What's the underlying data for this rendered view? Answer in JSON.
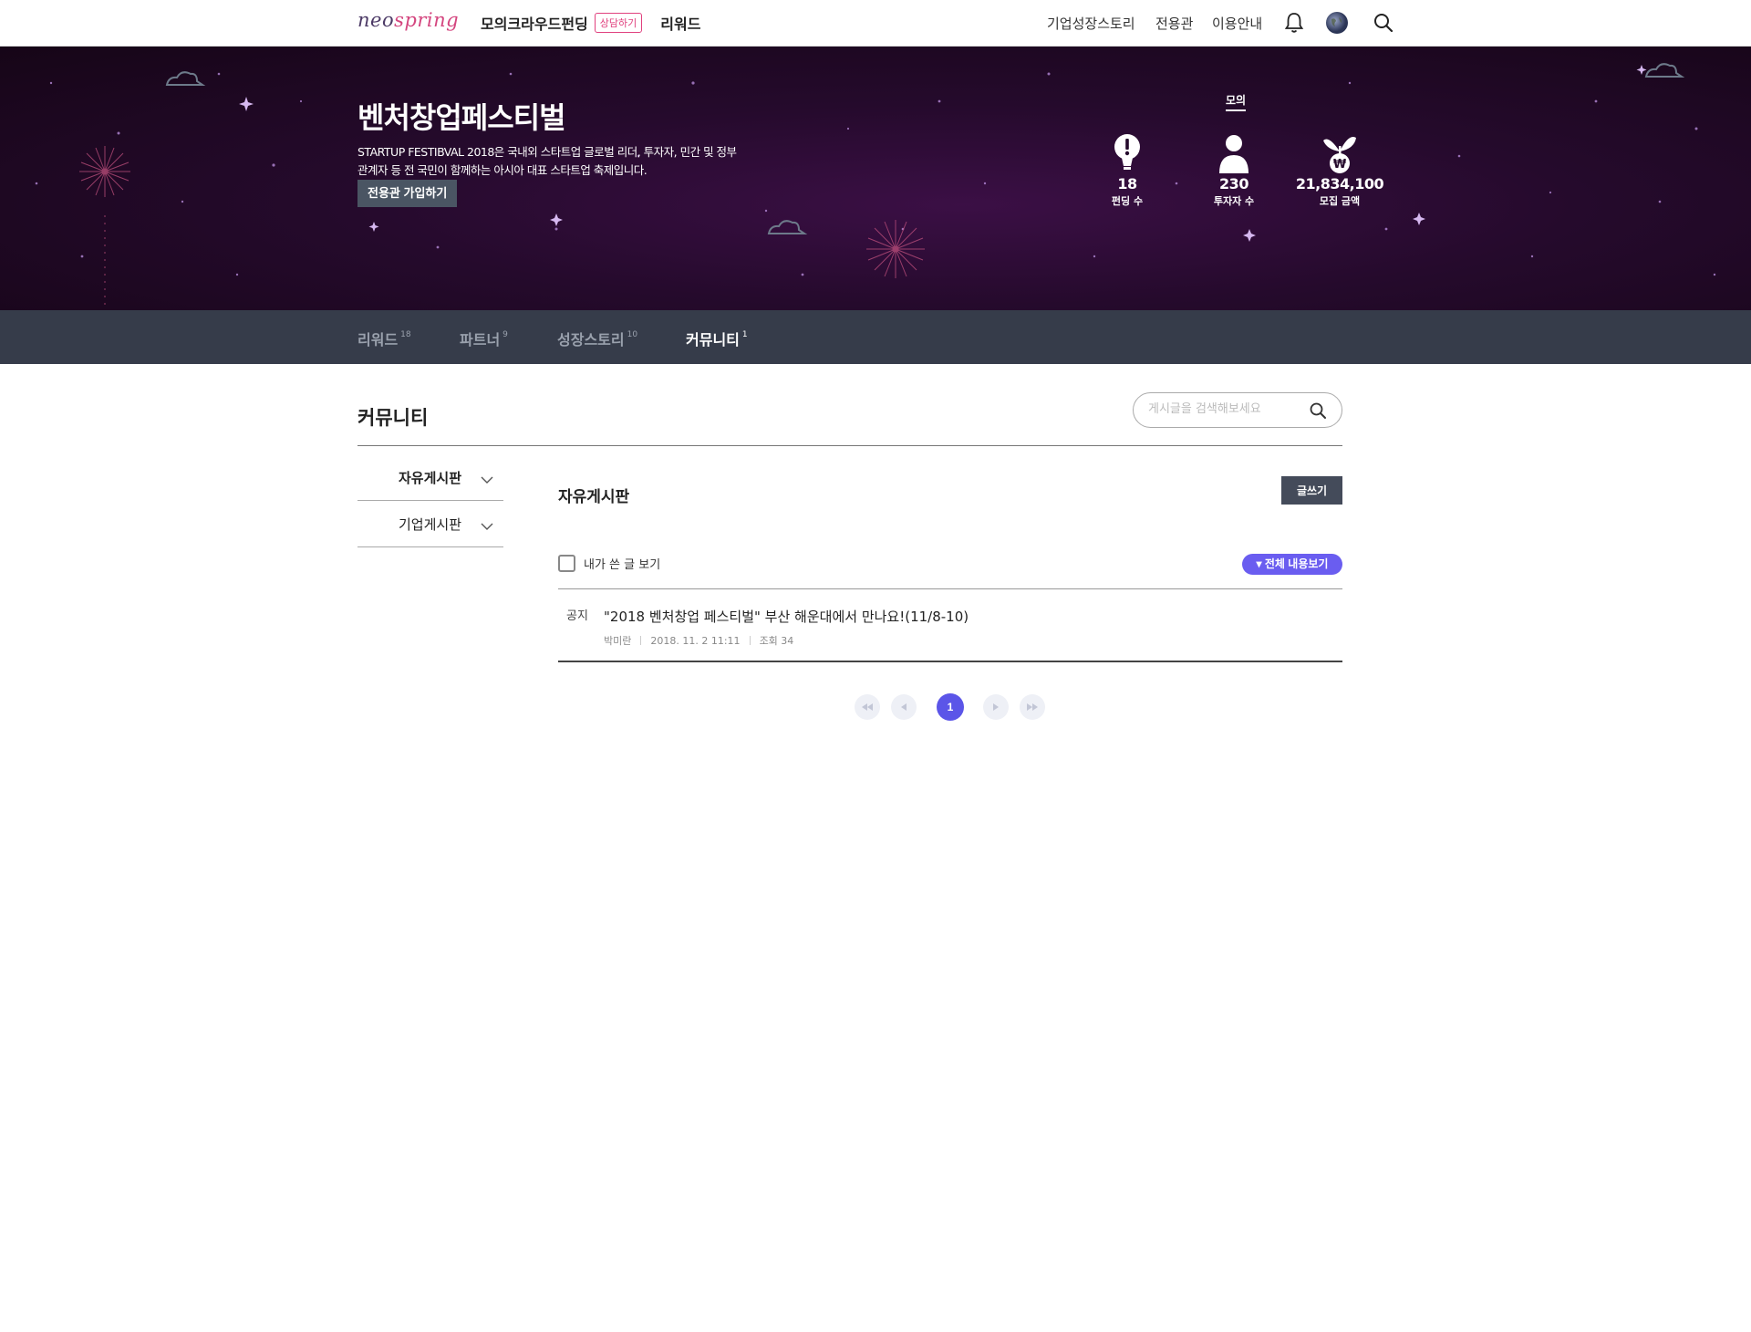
{
  "header": {
    "logo_part1": "neo",
    "logo_part2": "spring",
    "nav_crowdfunding": "모의크라우드펀딩",
    "consult_badge": "상담하기",
    "nav_reward": "리워드",
    "nav_growth_story": "기업성장스토리",
    "nav_exclusive": "전용관",
    "nav_guide": "이용안내",
    "icons": [
      "bell-icon",
      "globe-avatar-icon",
      "search-icon"
    ]
  },
  "hero": {
    "title": "벤처창업페스티벌",
    "desc_line1": "STARTUP FESTIBVAL 2018은 국내외 스타트업 글로벌 리더, 투자자, 민간 및 정부",
    "desc_line2": "관계자 등 전 국민이 함께하는 아시아 대표 스타트업 축제입니다.",
    "join_button": "전용관 가입하기",
    "stats_title": "모의",
    "stats": [
      {
        "icon": "bulb-icon",
        "value": "18",
        "label": "펀딩 수"
      },
      {
        "icon": "person-icon",
        "value": "230",
        "label": "투자자 수"
      },
      {
        "icon": "money-sprout-icon",
        "value": "21,834,100",
        "label": "모집 금액"
      }
    ],
    "background_color": "#250a2c"
  },
  "tabs": [
    {
      "label": "리워드",
      "count": "18",
      "active": false
    },
    {
      "label": "파트너",
      "count": "9",
      "active": false
    },
    {
      "label": "성장스토리",
      "count": "10",
      "active": false
    },
    {
      "label": "커뮤니티",
      "count": "1",
      "active": true
    }
  ],
  "content": {
    "page_title": "커뮤니티",
    "search_placeholder": "게시글을 검색해보세요",
    "sidebar": [
      {
        "label": "자유게시판",
        "active": true
      },
      {
        "label": "기업게시판",
        "active": false
      }
    ],
    "board_title": "자유게시판",
    "write_button": "글쓰기",
    "my_posts_label": "내가 쓴 글 보기",
    "view_all_button": "▾ 전체 내용보기",
    "posts": [
      {
        "tag": "공지",
        "title": "\"2018 벤처창업 페스티벌\" 부산 해운대에서 만나요!(11/8-10)",
        "author": "박미란",
        "date": "2018. 11. 2 11:11",
        "views": "조회 34"
      }
    ],
    "pagination": {
      "current": "1"
    },
    "accent_color": "#5b55e8"
  }
}
